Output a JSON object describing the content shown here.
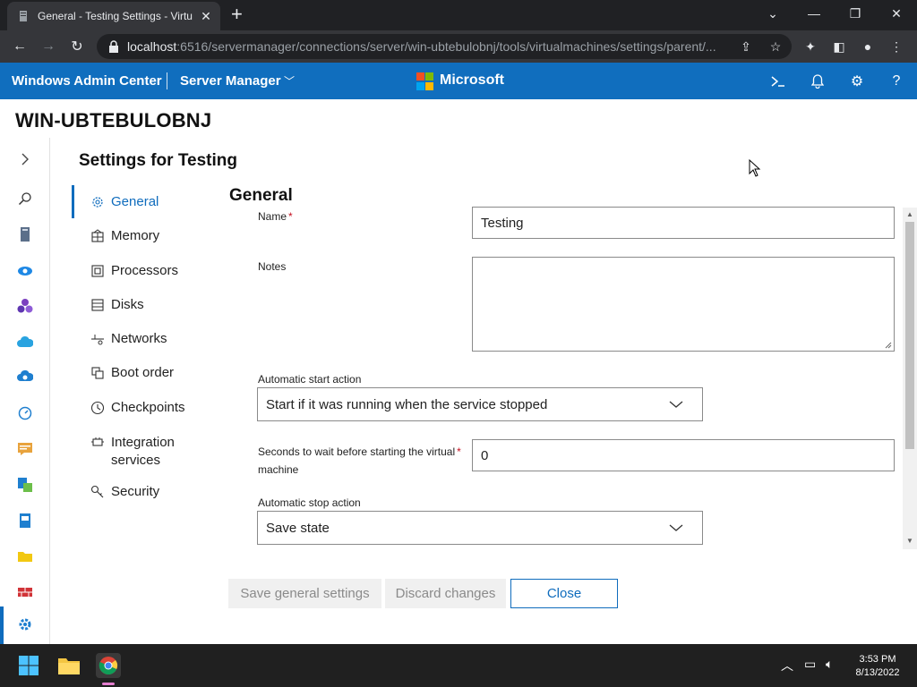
{
  "browser": {
    "tab_title": "General - Testing Settings - Virtu",
    "url_host": "localhost",
    "url_rest": ":6516/servermanager/connections/server/win-ubtebulobnj/tools/virtualmachines/settings/parent/..."
  },
  "header": {
    "app_title": "Windows Admin Center",
    "context": "Server Manager",
    "brand": "Microsoft",
    "accent": "#106ebe"
  },
  "server_name": "WIN-UBTEBULOBNJ",
  "settings": {
    "title": "Settings for Testing",
    "nav": [
      {
        "label": "General",
        "icon": "gear-icon"
      },
      {
        "label": "Memory",
        "icon": "memory-icon"
      },
      {
        "label": "Processors",
        "icon": "processor-icon"
      },
      {
        "label": "Disks",
        "icon": "disk-icon"
      },
      {
        "label": "Networks",
        "icon": "network-icon"
      },
      {
        "label": "Boot order",
        "icon": "boot-order-icon"
      },
      {
        "label": "Checkpoints",
        "icon": "clock-icon"
      },
      {
        "label": "Integration services",
        "icon": "integration-icon"
      },
      {
        "label": "Security",
        "icon": "key-icon"
      }
    ]
  },
  "general": {
    "section_title": "General",
    "name_label": "Name",
    "name_value": "Testing",
    "notes_label": "Notes",
    "notes_value": "",
    "auto_start_label": "Automatic start action",
    "auto_start_value": "Start if it was running when the service stopped",
    "wait_label_line1": "Seconds to wait before starting the virtual",
    "wait_label_line2": "machine",
    "wait_value": "0",
    "auto_stop_label": "Automatic stop action",
    "auto_stop_value": "Save state",
    "required_mark": "*"
  },
  "buttons": {
    "save": "Save general settings",
    "discard": "Discard changes",
    "close": "Close"
  },
  "taskbar": {
    "time": "3:53 PM",
    "date": "8/13/2022"
  }
}
